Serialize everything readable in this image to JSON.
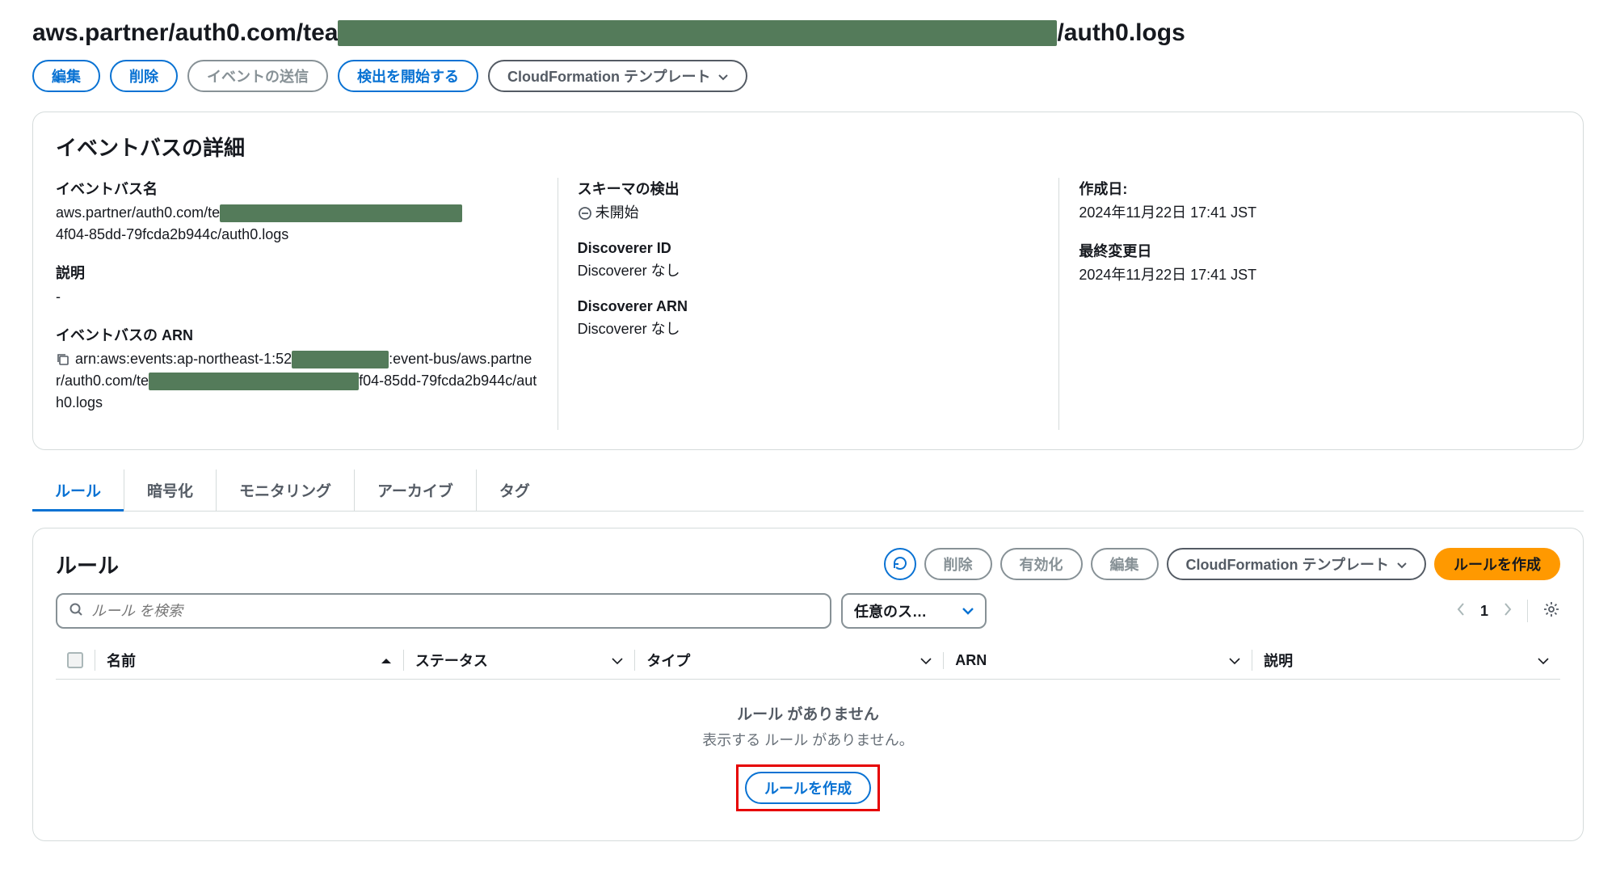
{
  "title": {
    "prefix": "aws.partner/auth0.com/tea",
    "suffix": "/auth0.logs"
  },
  "actions": {
    "edit": "編集",
    "delete": "削除",
    "send_events": "イベントの送信",
    "start_discovery": "検出を開始する",
    "cloudformation": "CloudFormation テンプレート"
  },
  "details": {
    "panel_title": "イベントバスの詳細",
    "name_label": "イベントバス名",
    "name_value_pre": "aws.partner/auth0.com/te",
    "name_value_post": "4f04-85dd-79fcda2b944c/auth0.logs",
    "description_label": "説明",
    "description_value": "-",
    "arn_label": "イベントバスの ARN",
    "arn_value_pre": "arn:aws:events:ap-northeast-1:52",
    "arn_value_mid": ":event-bus/aws.partner/auth0.com/te",
    "arn_value_post": "f04-85dd-79fcda2b944c/auth0.logs",
    "schema_label": "スキーマの検出",
    "schema_value": "未開始",
    "discoverer_id_label": "Discoverer ID",
    "discoverer_id_value": "Discoverer なし",
    "discoverer_arn_label": "Discoverer ARN",
    "discoverer_arn_value": "Discoverer なし",
    "created_label": "作成日:",
    "created_value": "2024年11月22日 17:41 JST",
    "modified_label": "最終変更日",
    "modified_value": "2024年11月22日 17:41 JST"
  },
  "tabs": {
    "rules": "ルール",
    "encryption": "暗号化",
    "monitoring": "モニタリング",
    "archive": "アーカイブ",
    "tags": "タグ"
  },
  "rules": {
    "title": "ルール",
    "refresh": "更新",
    "delete": "削除",
    "enable": "有効化",
    "edit": "編集",
    "cloudformation": "CloudFormation テンプレート",
    "create": "ルールを作成",
    "search_placeholder": "ルール を検索",
    "status_filter": "任意のス…",
    "page": "1",
    "columns": {
      "name": "名前",
      "status": "ステータス",
      "type": "タイプ",
      "arn": "ARN",
      "description": "説明"
    },
    "empty_title": "ルール がありません",
    "empty_sub": "表示する ルール がありません。",
    "empty_create": "ルールを作成"
  }
}
